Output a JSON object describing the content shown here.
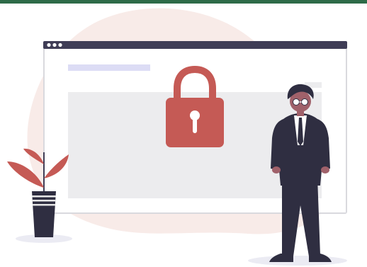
{
  "theme": {
    "top_bar": "#2e6b48",
    "blob": "#f8ebe8",
    "browser_frame": "#d9d9de",
    "browser_titlebar": "#3f3d56",
    "browser_body": "#ffffff",
    "content_panel": "#ececee",
    "placeholder_bar": "#dcdcf5",
    "lock": "#c55a55",
    "lock_hole": "#ffffff",
    "suit": "#2f2e41",
    "skin": "#a0616a",
    "shirt": "#ffffff",
    "glasses": "#ffffff",
    "plant_leaf": "#c55a55",
    "plant_stem": "#3f3d56",
    "pot": "#2f2e41",
    "pot_stripes": "#e6e6e6",
    "ground_shadow": "#ebebf3"
  },
  "icons": {
    "lock": "padlock-icon",
    "window_dots": "window-controls"
  }
}
